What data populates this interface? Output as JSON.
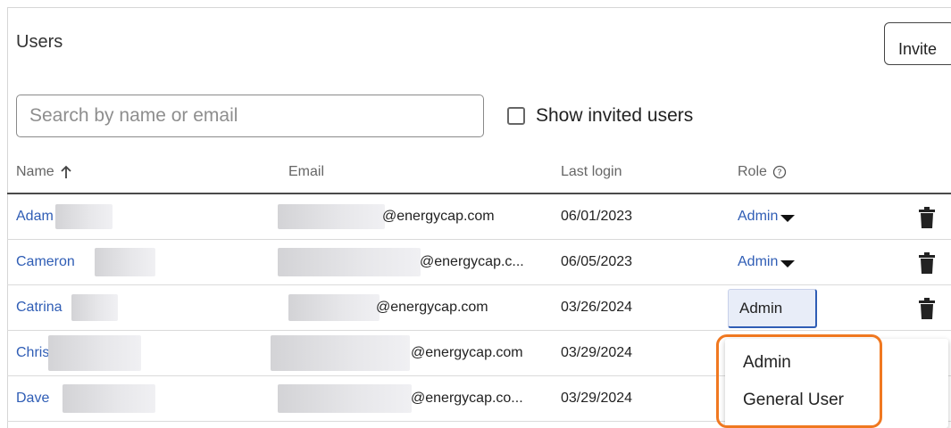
{
  "header": {
    "title": "Users",
    "invite_label": "Invite"
  },
  "search": {
    "placeholder": "Search by name or email",
    "value": ""
  },
  "filter": {
    "show_invited_label": "Show invited users",
    "checked": false
  },
  "columns": {
    "name": "Name",
    "sort_icon": "arrow-up-icon",
    "email": "Email",
    "last_login": "Last login",
    "role": "Role",
    "role_help_icon": "help-circle-icon"
  },
  "rows": [
    {
      "name": "Adam",
      "email": "@energycap.com",
      "last_login": "06/01/2023",
      "role": "Admin"
    },
    {
      "name": "Cameron",
      "email": "@energycap.c...",
      "last_login": "06/05/2023",
      "role": "Admin"
    },
    {
      "name": "Catrina",
      "email": "@energycap.com",
      "last_login": "03/26/2024",
      "role": "Admin"
    },
    {
      "name": "Chris",
      "email": "@energycap.com",
      "last_login": "03/29/2024",
      "role": ""
    },
    {
      "name": "Dave",
      "email": "@energycap.co...",
      "last_login": "03/29/2024",
      "role": ""
    }
  ],
  "role_dropdown": {
    "options": [
      "Admin",
      "General User"
    ]
  },
  "colors": {
    "link": "#2f5db5",
    "highlight": "#f07820",
    "header_rule": "#4a4a4a"
  }
}
